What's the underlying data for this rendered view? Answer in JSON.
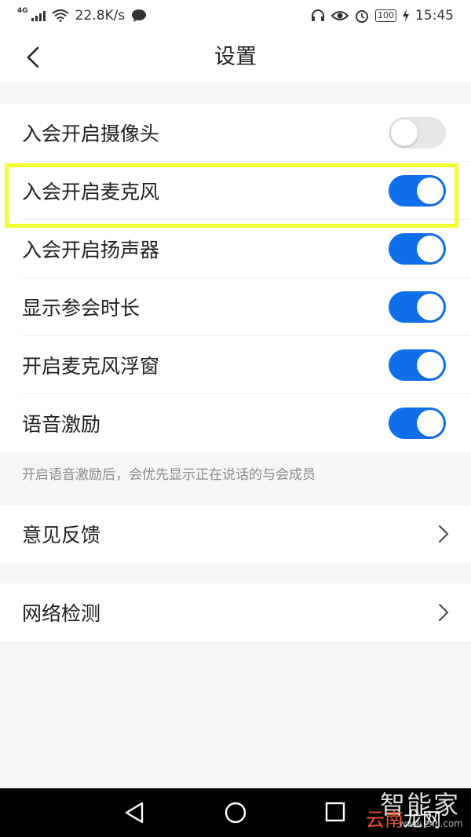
{
  "status_bar": {
    "network_type": "4G",
    "speed": "22.8K/s",
    "battery": "100",
    "time": "15:45"
  },
  "header": {
    "title": "设置"
  },
  "settings": [
    {
      "label": "入会开启摄像头",
      "enabled": false
    },
    {
      "label": "入会开启麦克风",
      "enabled": true
    },
    {
      "label": "入会开启扬声器",
      "enabled": true
    },
    {
      "label": "显示参会时长",
      "enabled": true
    },
    {
      "label": "开启麦克风浮窗",
      "enabled": true
    },
    {
      "label": "语音激励",
      "enabled": true
    }
  ],
  "hint": "开启语音激励后，会优先显示正在说话的与会成员",
  "links": [
    {
      "label": "意见反馈"
    },
    {
      "label": "网络检测"
    }
  ],
  "watermark": {
    "line1": "智能家",
    "line2_a": "云南",
    "line2_b": "龙网",
    "line3": "www.zhjj.com"
  },
  "colors": {
    "accent": "#0f6fe8",
    "highlight": "#f6ff2e"
  }
}
